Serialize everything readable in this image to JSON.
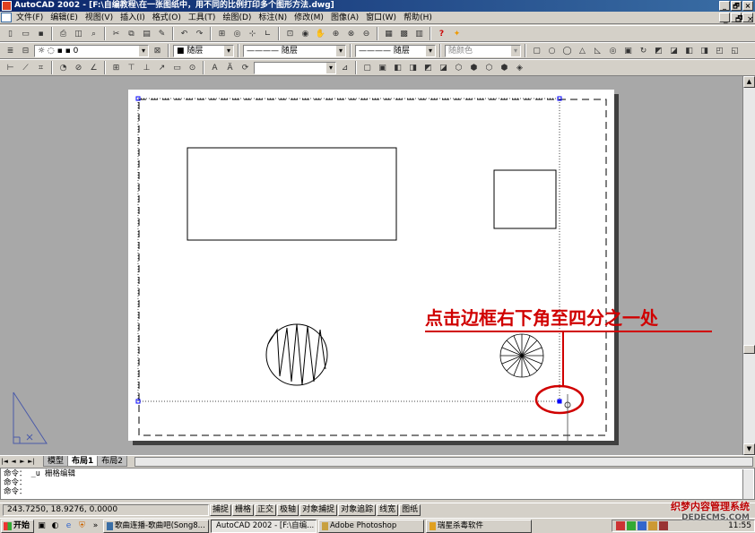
{
  "window": {
    "title": "AutoCAD 2002 - [F:\\自编教程\\在一张图纸中，用不同的比例打印多个图形方法.dwg]",
    "controls": [
      "_",
      "🗗",
      "×"
    ]
  },
  "menu": {
    "items": [
      "文件(F)",
      "编辑(E)",
      "视图(V)",
      "插入(I)",
      "格式(O)",
      "工具(T)",
      "绘图(D)",
      "标注(N)",
      "修改(M)",
      "图像(A)",
      "窗口(W)",
      "帮助(H)"
    ]
  },
  "properties_toolbar": {
    "layer_value": "0",
    "color_value": "■ 随层",
    "linetype_value": "———— 随层",
    "lineweight_value": "———— 随层",
    "plotstyle_value": "随颜色"
  },
  "annotation": {
    "text": "点击边框右下角至四分之一处",
    "color": "#d00000"
  },
  "layout_tabs": {
    "nav": [
      "|◄",
      "◄",
      "►",
      "►|"
    ],
    "tabs": [
      "模型",
      "布局1",
      "布局2"
    ],
    "active": "布局1"
  },
  "command": {
    "lines": [
      "命令： _u  栅格编辑",
      "命令：",
      "命令："
    ]
  },
  "status": {
    "coords": "243.7250, 18.9276, 0.0000",
    "toggles": [
      "捕捉",
      "栅格",
      "正交",
      "极轴",
      "对象捕捉",
      "对象追踪",
      "线宽",
      "图纸"
    ]
  },
  "taskbar": {
    "start": "开始",
    "tasks": [
      "歌曲连播-歌曲吧(Song8...",
      "AutoCAD 2002 - [F:\\自编...",
      "Adobe Photoshop",
      "瑞星杀毒软件"
    ],
    "active_task": 1,
    "clock": "11:55"
  },
  "watermark": {
    "line1": "织梦内容管理系统",
    "line2": "DEDECMS.COM"
  }
}
